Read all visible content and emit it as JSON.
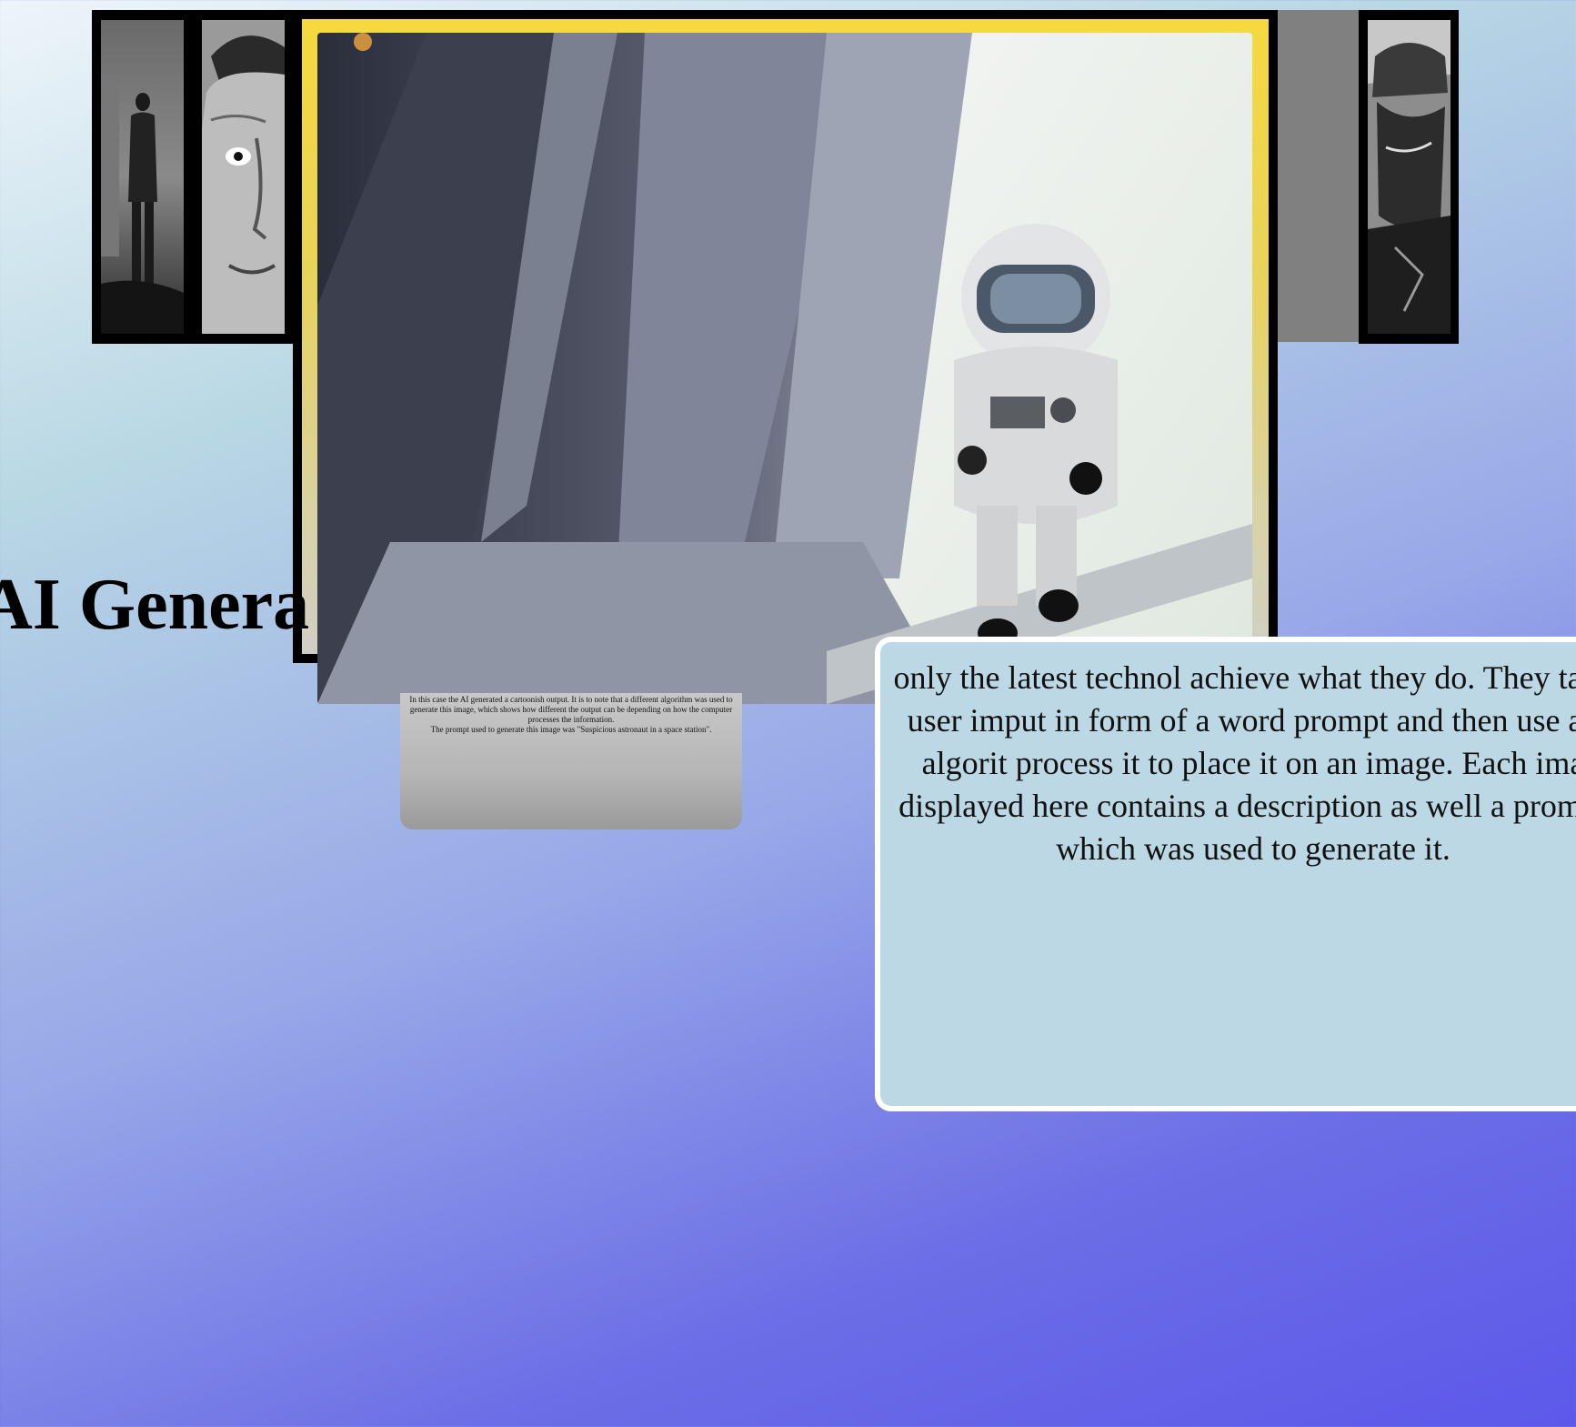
{
  "page": {
    "heading": "AI Genera",
    "info_text": "only the latest technol achieve what they do. They take user imput in form of a word prompt and then use an algorit process it to place it on an image. Each ima displayed here contains a description as well a prompt which was used to generate it.",
    "caption": {
      "line1": "In this case the AI generated a cartoonish output. It is to note that a different algorithm was used to generate this image, which shows how different the output can be depending on how the computer processes the information.",
      "line2": "The prompt used to generate this image was \"Suspicious astronaut in a space station\"."
    }
  },
  "gallery": {
    "thumbnails": [
      {
        "icon": "man-standing-in-fog-image"
      },
      {
        "icon": "man-face-portrait-image"
      },
      {
        "icon": "soldier-statue-image"
      }
    ],
    "featured": {
      "icon": "astronaut-in-space-station-image"
    }
  },
  "colors": {
    "frame_accent": "#f5d93e",
    "card_background": "#bcd8e4",
    "page_gradient_end": "#5d58ea"
  }
}
